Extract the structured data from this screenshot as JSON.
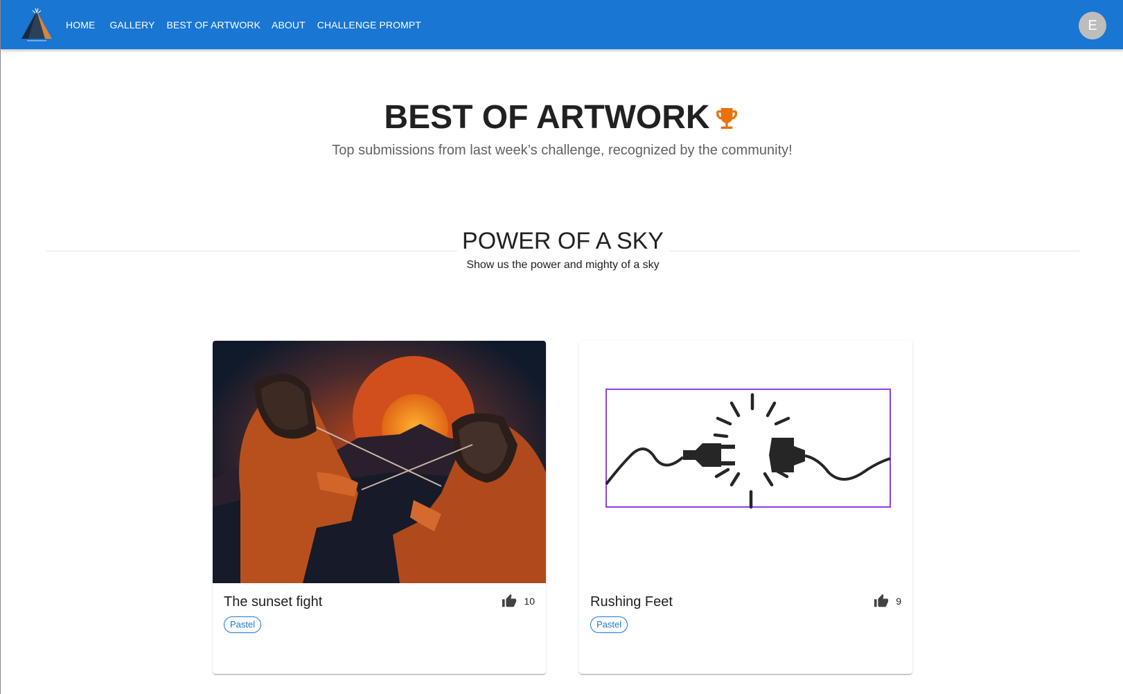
{
  "nav": {
    "logo_icon": "artwork-logo-icon",
    "items": [
      {
        "label": "HOME"
      },
      {
        "label": "GALLERY"
      },
      {
        "label": "BEST OF ARTWORK"
      },
      {
        "label": "ABOUT"
      },
      {
        "label": "CHALLENGE PROMPT"
      }
    ],
    "avatar_initial": "E"
  },
  "header": {
    "title": "BEST OF ARTWORK",
    "title_icon": "trophy-icon",
    "subtitle": "Top submissions from last week’s challenge, recognized by the community!"
  },
  "challenge": {
    "title": "POWER OF A SKY",
    "description": "Show us the power and mighty of a sky"
  },
  "cards": [
    {
      "title": "The sunset fight",
      "likes": "10",
      "tag": "Pastel",
      "image": "fencers-sunset-painting"
    },
    {
      "title": "Rushing Feet",
      "likes": "9",
      "tag": "Pastel",
      "image": "unplugged-plug-illustration"
    }
  ],
  "colors": {
    "appbar": "#1976d2",
    "accent": "#1976d2",
    "trophy": "#e8710a",
    "selection_outline": "#8b3fe8"
  }
}
